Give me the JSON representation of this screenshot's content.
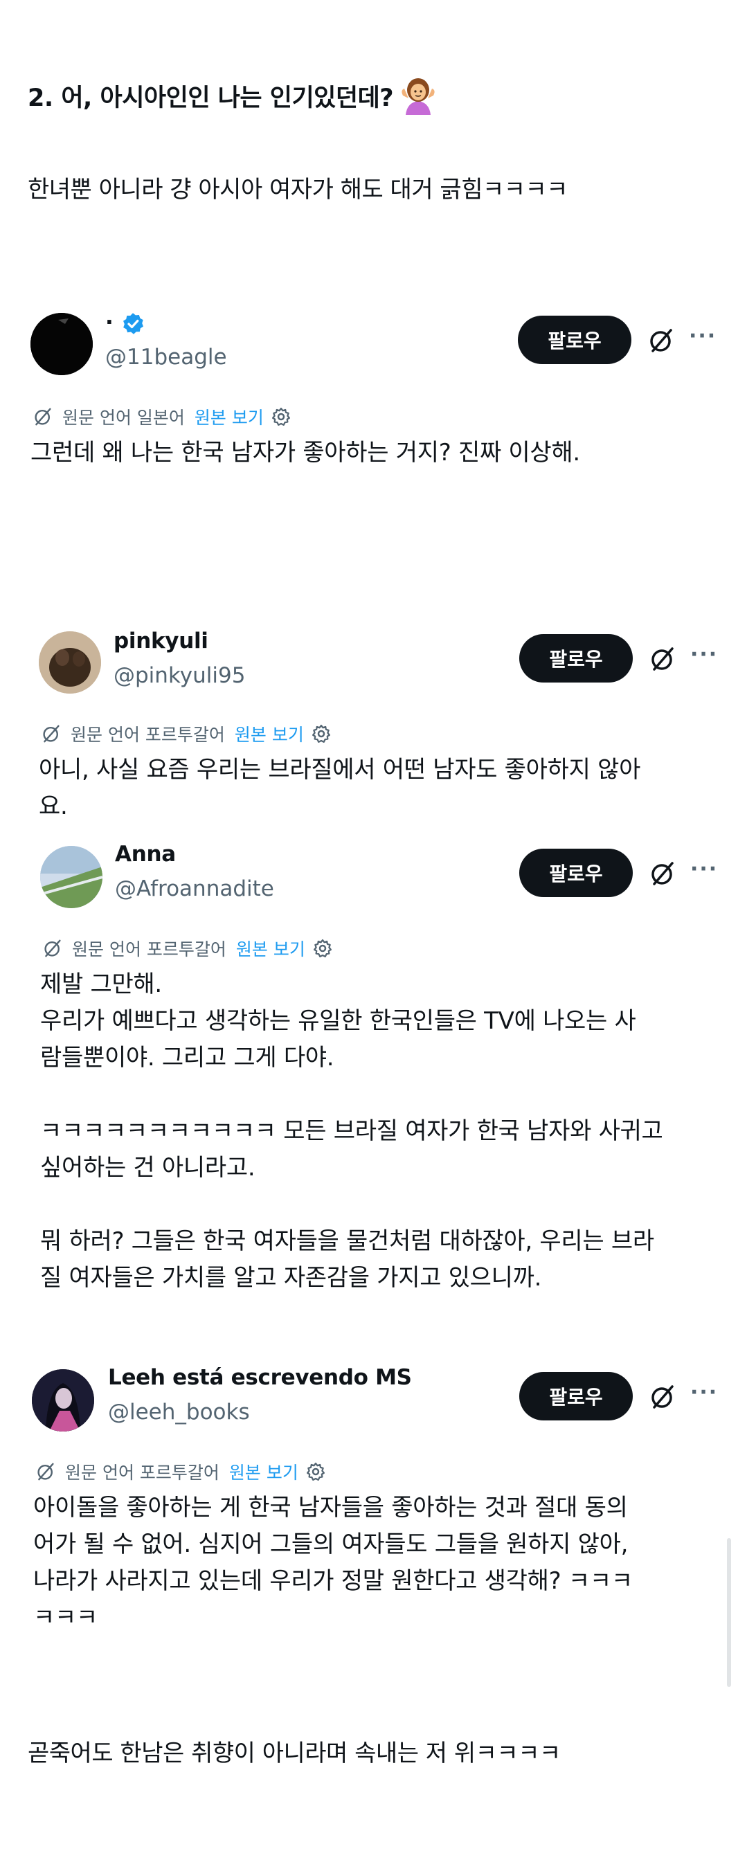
{
  "heading": "2. 어, 아시아인인 나는 인기있던데?",
  "intro": "한녀뿐 아니라 걍 아시아 여자가 해도 대거 긁힘ㅋㅋㅋㅋ",
  "outro": "곧죽어도 한남은 취향이 아니라며 속내는 저 위ㅋㅋㅋㅋ",
  "colors": {
    "link": "#1d9bf0",
    "muted": "#536471",
    "button": "#0f1419",
    "verified": "#1d9bf0"
  },
  "tweets": [
    {
      "name": "·",
      "handle": "@11beagle",
      "verified": true,
      "follow": "팔로우",
      "more": "···",
      "translation": {
        "label": "원문 언어 일본어",
        "link": "원본 보기"
      },
      "text": "그런데 왜 나는 한국 남자가 좋아하는 거지? 진짜 이상해."
    },
    {
      "name": "pinkyuli",
      "handle": "@pinkyuli95",
      "follow": "팔로우",
      "more": "···",
      "translation": {
        "label": "원문 언어 포르투갈어",
        "link": "원본 보기"
      },
      "text": "아니, 사실 요즘 우리는 브라질에서 어떤 남자도 좋아하지 않아\n요."
    },
    {
      "name": "Anna",
      "handle": "@Afroannadite",
      "follow": "팔로우",
      "more": "···",
      "translation": {
        "label": "원문 언어 포르투갈어",
        "link": "원본 보기"
      },
      "text": "제발 그만해.\n우리가 예쁘다고 생각하는 유일한 한국인들은 TV에 나오는 사\n람들뿐이야. 그리고 그게 다야.\n\nㅋㅋㅋㅋㅋㅋㅋㅋㅋㅋㅋ 모든 브라질 여자가 한국 남자와 사귀고\n싶어하는 건 아니라고.\n\n뭐 하러? 그들은 한국 여자들을 물건처럼 대하잖아, 우리는 브라\n질 여자들은 가치를 알고 자존감을 가지고 있으니까."
    },
    {
      "name": "Leeh está escrevendo MS",
      "handle": "@leeh_books",
      "follow": "팔로우",
      "more": "···",
      "translation": {
        "label": "원문 언어 포르투갈어",
        "link": "원본 보기"
      },
      "text": "아이돌을 좋아하는 게 한국 남자들을 좋아하는 것과 절대 동의\n어가 될 수 없어. 심지어 그들의 여자들도 그들을 원하지 않아,\n나라가 사라지고 있는데 우리가 정말 원한다고 생각해? ㅋㅋㅋ\nㅋㅋㅋ"
    }
  ]
}
